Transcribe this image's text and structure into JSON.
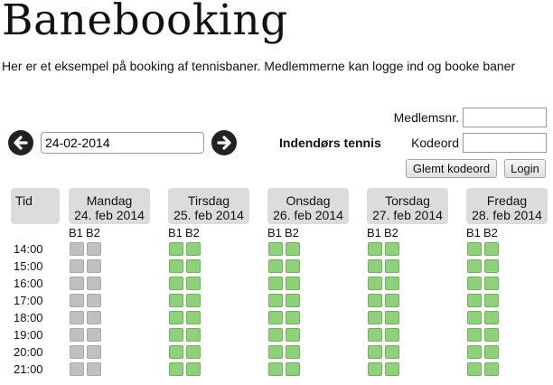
{
  "page": {
    "title": "Banebooking",
    "intro": "Her er et eksempel på booking af tennisbaner. Medlemmerne kan logge ind og booke baner"
  },
  "login": {
    "member_label": "Medlemsnr.",
    "member_value": "",
    "password_label": "Kodeord",
    "password_value": "",
    "forgot_button": "Glemt kodeord",
    "login_button": "Login"
  },
  "nav": {
    "date": "24-02-2014",
    "prev_icon": "arrow-left-icon",
    "next_icon": "arrow-right-icon"
  },
  "sport": "Indendørs tennis",
  "grid": {
    "time_header": "Tid",
    "days": [
      {
        "name": "Mandag",
        "date": "24. feb 2014",
        "courts": [
          "B1",
          "B2"
        ],
        "available": false
      },
      {
        "name": "Tirsdag",
        "date": "25. feb 2014",
        "courts": [
          "B1",
          "B2"
        ],
        "available": true
      },
      {
        "name": "Onsdag",
        "date": "26. feb 2014",
        "courts": [
          "B1",
          "B2"
        ],
        "available": true
      },
      {
        "name": "Torsdag",
        "date": "27. feb 2014",
        "courts": [
          "B1",
          "B2"
        ],
        "available": true
      },
      {
        "name": "Fredag",
        "date": "28. feb 2014",
        "courts": [
          "B1",
          "B2"
        ],
        "available": true
      }
    ],
    "times": [
      "14:00",
      "15:00",
      "16:00",
      "17:00",
      "18:00",
      "19:00",
      "20:00",
      "21:00"
    ]
  },
  "colors": {
    "available": "#8fd07a",
    "unavailable": "#c0c0c0",
    "header_bg": "#dcdcdc"
  }
}
